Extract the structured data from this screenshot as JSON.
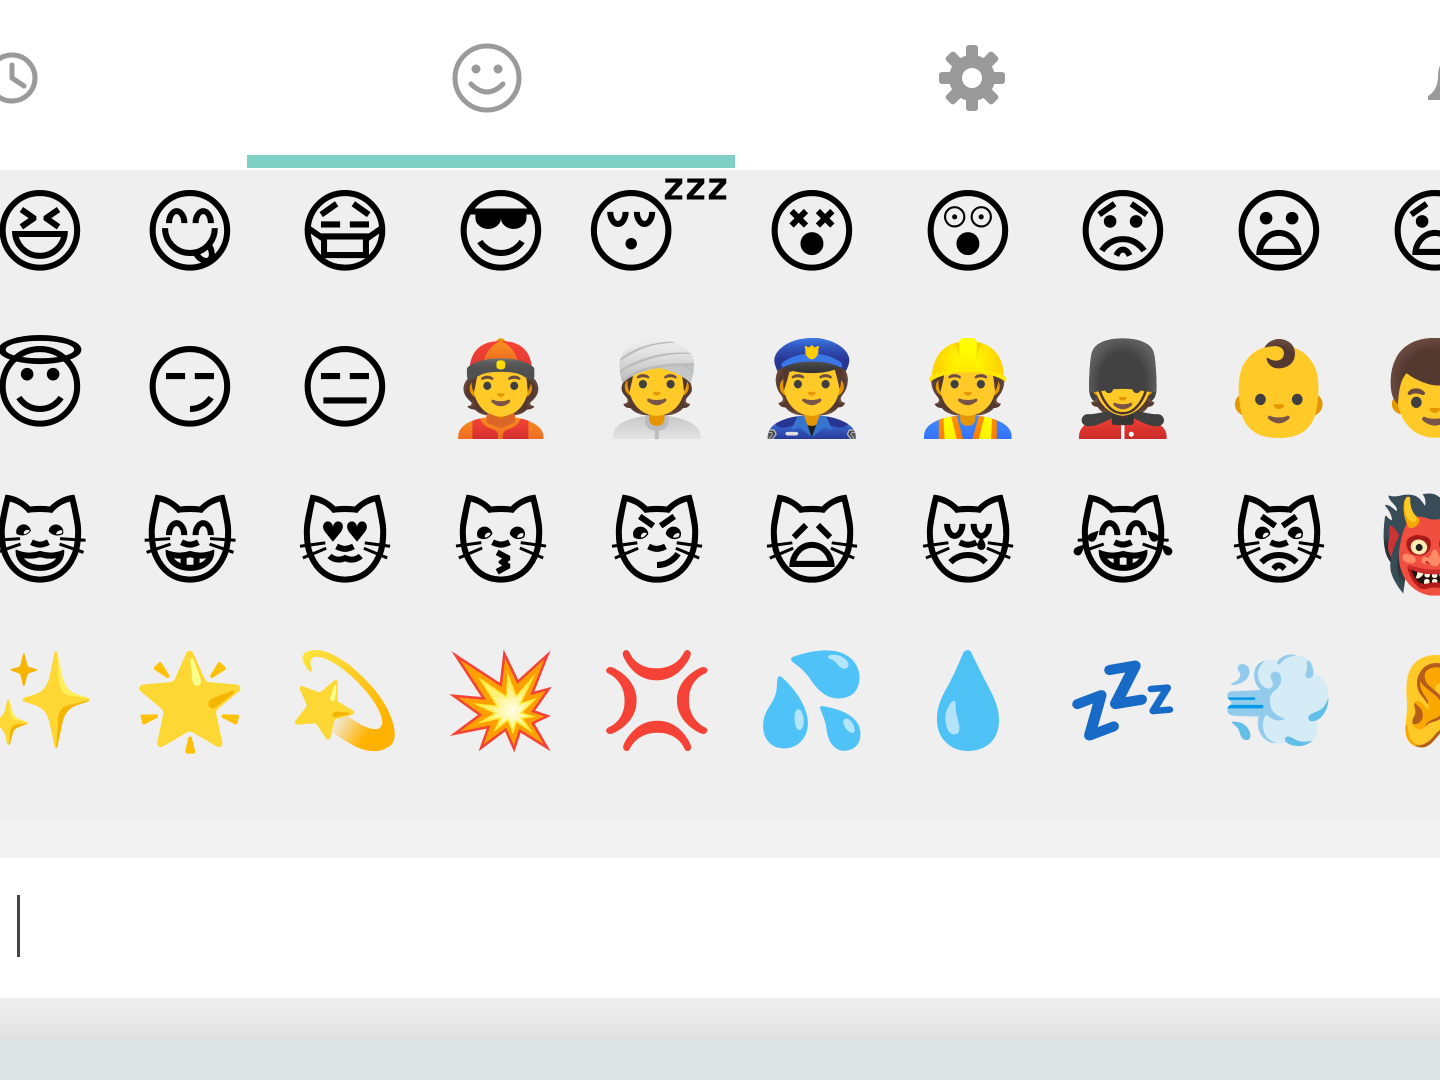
{
  "colors": {
    "accent": "#7dd0c3",
    "icon": "#9a9a9a",
    "panel_bg": "#efefef"
  },
  "tabs": [
    {
      "icon": "clock-icon",
      "active": false
    },
    {
      "icon": "smiley-icon",
      "active": true
    },
    {
      "icon": "gear-icon",
      "active": false
    },
    {
      "icon": "bell-icon",
      "active": false
    }
  ],
  "emoji_grid": {
    "rows": [
      [
        "😆",
        "😋",
        "😷",
        "😎",
        "😴",
        "😵",
        "😲",
        "😟",
        "😦",
        "😧"
      ],
      [
        "😇",
        "😏",
        "😑",
        "👲",
        "👳",
        "👮",
        "👷",
        "💂",
        "👶",
        "👦"
      ],
      [
        "😺",
        "😸",
        "😻",
        "😽",
        "😼",
        "🙀",
        "😿",
        "😹",
        "😾",
        "👹"
      ],
      [
        "✨",
        "🌟",
        "💫",
        "💥",
        "💢",
        "💦",
        "💧",
        "💤",
        "💨",
        "👂"
      ]
    ]
  },
  "message_input": {
    "value": "",
    "placeholder": ""
  }
}
